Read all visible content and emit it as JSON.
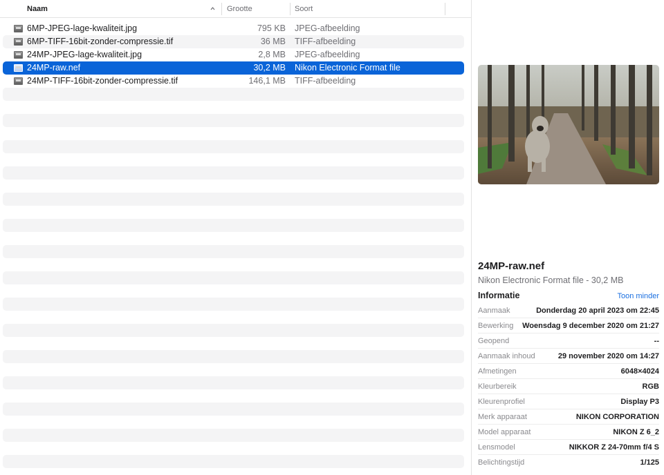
{
  "columns": {
    "name": "Naam",
    "size": "Grootte",
    "kind": "Soort"
  },
  "files": [
    {
      "name": "6MP-JPEG-lage-kwaliteit.jpg",
      "size": "795 KB",
      "kind": "JPEG-afbeelding",
      "selected": false,
      "icon": "image-file-icon"
    },
    {
      "name": "6MP-TIFF-16bit-zonder-compressie.tif",
      "size": "36 MB",
      "kind": "TIFF-afbeelding",
      "selected": false,
      "icon": "image-file-icon"
    },
    {
      "name": "24MP-JPEG-lage-kwaliteit.jpg",
      "size": "2,8 MB",
      "kind": "JPEG-afbeelding",
      "selected": false,
      "icon": "image-file-icon"
    },
    {
      "name": "24MP-raw.nef",
      "size": "30,2 MB",
      "kind": "Nikon Electronic Format file",
      "selected": true,
      "icon": "image-file-icon"
    },
    {
      "name": "24MP-TIFF-16bit-zonder-compressie.tif",
      "size": "146,1 MB",
      "kind": "TIFF-afbeelding",
      "selected": false,
      "icon": "image-file-icon"
    }
  ],
  "preview": {
    "title": "24MP-raw.nef",
    "subtitle": "Nikon Electronic Format file - 30,2 MB",
    "info_heading": "Informatie",
    "toggle_label": "Toon minder",
    "metadata": [
      {
        "label": "Aanmaak",
        "value": "Donderdag 20 april 2023 om 22:45"
      },
      {
        "label": "Bewerking",
        "value": "Woensdag 9 december 2020 om 21:27"
      },
      {
        "label": "Geopend",
        "value": "--"
      },
      {
        "label": "Aanmaak inhoud",
        "value": "29 november 2020 om 14:27"
      },
      {
        "label": "Afmetingen",
        "value": "6048×4024"
      },
      {
        "label": "Kleurbereik",
        "value": "RGB"
      },
      {
        "label": "Kleurenprofiel",
        "value": "Display P3"
      },
      {
        "label": "Merk apparaat",
        "value": "NIKON CORPORATION"
      },
      {
        "label": "Model apparaat",
        "value": "NIKON Z 6_2"
      },
      {
        "label": "Lensmodel",
        "value": "NIKKOR Z 24-70mm f/4 S"
      },
      {
        "label": "Belichtingstijd",
        "value": "1/125"
      }
    ]
  },
  "colors": {
    "selection": "#0a64d8",
    "stripe": "#f4f4f5",
    "link": "#1a6fe0"
  }
}
